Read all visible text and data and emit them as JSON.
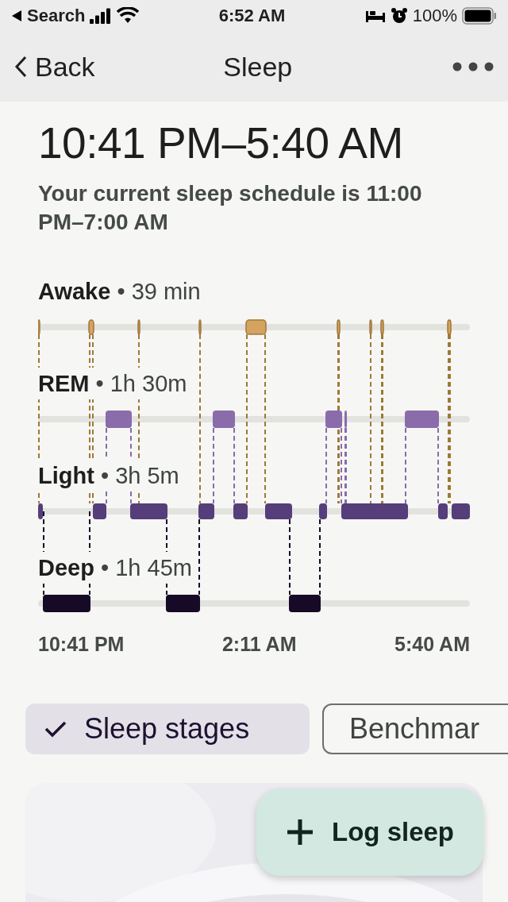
{
  "status_bar": {
    "back_app": "Search",
    "time": "6:52 AM",
    "battery": "100%"
  },
  "nav": {
    "back": "Back",
    "title": "Sleep"
  },
  "header": {
    "time_range": "10:41 PM–5:40 AM",
    "schedule": "Your current sleep schedule is 11:00 PM–7:00 AM"
  },
  "stages": [
    {
      "kind": "awake",
      "label": "**Awake** • 39 min"
    },
    {
      "kind": "rem",
      "label": "**REM** • 1h 30m"
    },
    {
      "kind": "light",
      "label": "**Light** • 3h 5m"
    },
    {
      "kind": "deep",
      "label": "**Deep** • 1h 45m"
    }
  ],
  "axis_labels": [
    "10:41 PM",
    "2:11 AM",
    "5:40 AM"
  ],
  "chips": [
    {
      "label": "Sleep stages",
      "selected": true
    },
    {
      "label": "Benchmar",
      "selected": false
    }
  ],
  "fab": {
    "label": "Log sleep"
  }
}
